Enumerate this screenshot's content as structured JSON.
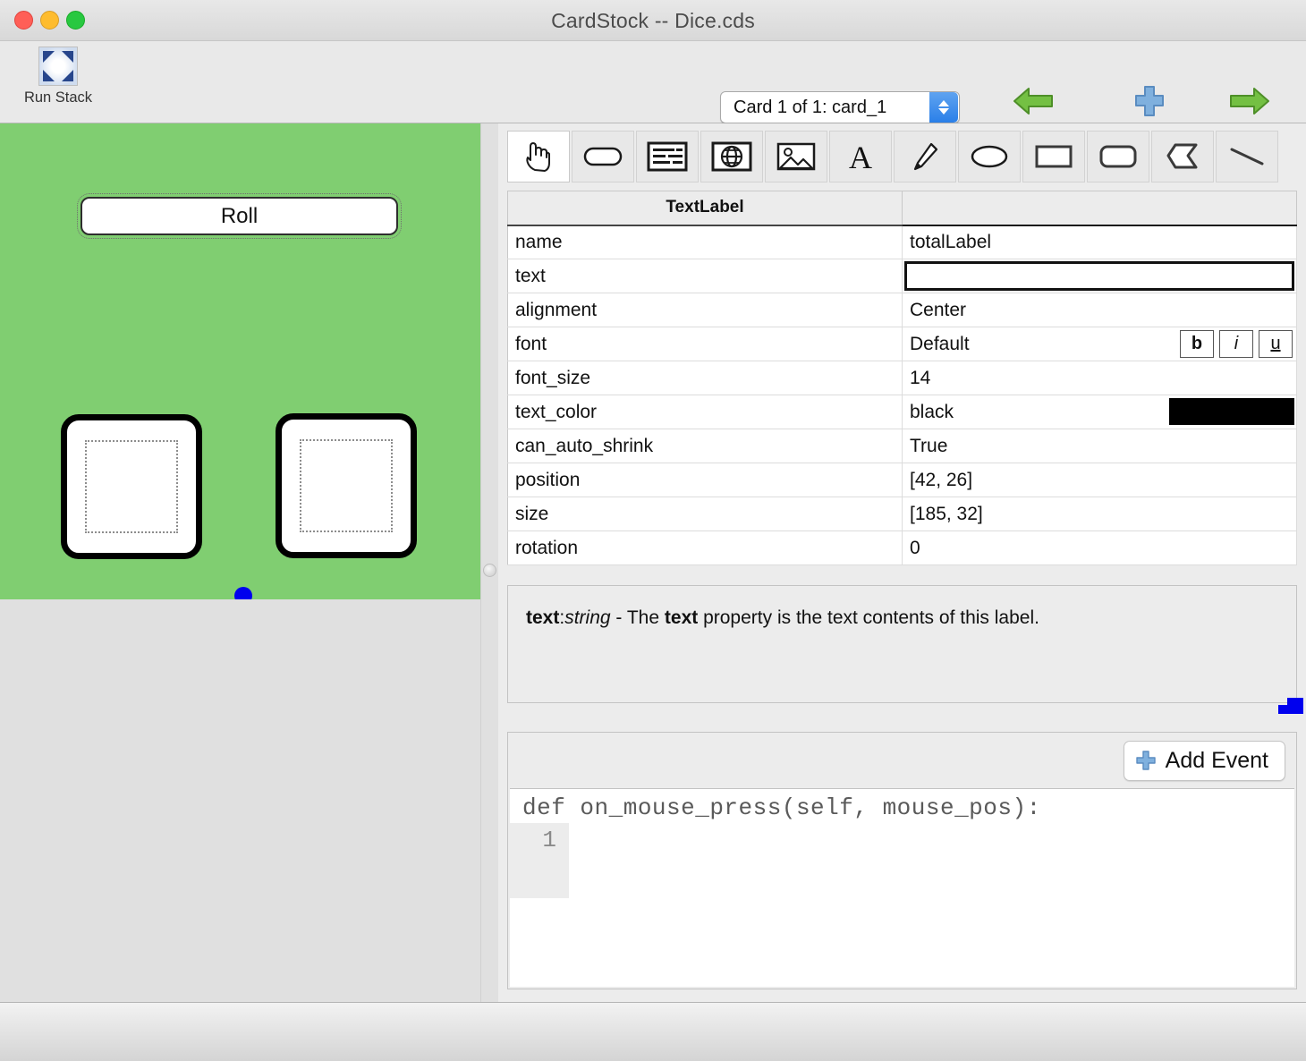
{
  "window": {
    "title": "CardStock -- Dice.cds",
    "traffic_lights": [
      "close-button",
      "minimize-button",
      "maximize-button"
    ]
  },
  "toolbar": {
    "run_stack_label": "Run Stack",
    "card_selector_value": "Card 1 of 1: card_1",
    "previous_card_label": "Previous Card",
    "add_card_label": "Add Card",
    "next_card_label": "Next Card"
  },
  "palette": {
    "tools": [
      {
        "name": "hand-tool",
        "icon": "pointing-hand-icon",
        "selected": true
      },
      {
        "name": "button-tool",
        "icon": "rounded-pill-icon",
        "selected": false
      },
      {
        "name": "textfield-tool",
        "icon": "text-field-icon",
        "selected": false
      },
      {
        "name": "webview-tool",
        "icon": "globe-icon",
        "selected": false
      },
      {
        "name": "image-tool",
        "icon": "picture-icon",
        "selected": false
      },
      {
        "name": "textlabel-tool",
        "icon": "letter-a-icon",
        "selected": false
      },
      {
        "name": "pen-tool",
        "icon": "pencil-icon",
        "selected": false
      },
      {
        "name": "oval-tool",
        "icon": "ellipse-icon",
        "selected": false
      },
      {
        "name": "rect-tool",
        "icon": "rectangle-icon",
        "selected": false
      },
      {
        "name": "roundrect-tool",
        "icon": "rounded-rectangle-icon",
        "selected": false
      },
      {
        "name": "polygon-tool",
        "icon": "polygon-icon",
        "selected": false
      },
      {
        "name": "line-tool",
        "icon": "line-icon",
        "selected": false
      }
    ]
  },
  "canvas": {
    "background_color": "#80ce71",
    "roll_button_label": "Roll",
    "dice": [
      "die-left",
      "die-right"
    ],
    "selection": {
      "handles": 4,
      "rotation_handle": true,
      "color": "#0000ee"
    }
  },
  "properties": {
    "header": {
      "type": "TextLabel",
      "value_header": ""
    },
    "rows": [
      {
        "key": "name",
        "value": "totalLabel",
        "kind": "text"
      },
      {
        "key": "text",
        "value": "",
        "kind": "editing"
      },
      {
        "key": "alignment",
        "value": "Center",
        "kind": "text"
      },
      {
        "key": "font",
        "value": "Default",
        "kind": "font"
      },
      {
        "key": "font_size",
        "value": "14",
        "kind": "text"
      },
      {
        "key": "text_color",
        "value": "black",
        "kind": "color",
        "swatch": "#000000"
      },
      {
        "key": "can_auto_shrink",
        "value": "True",
        "kind": "text"
      },
      {
        "key": "position",
        "value": "[42, 26]",
        "kind": "text"
      },
      {
        "key": "size",
        "value": "[185, 32]",
        "kind": "text"
      },
      {
        "key": "rotation",
        "value": "0",
        "kind": "text"
      }
    ],
    "style_buttons": {
      "bold": "b",
      "italic": "i",
      "underline": "u"
    }
  },
  "description": {
    "prop_name": "text",
    "prop_type": "string",
    "separator": " - ",
    "body_before": "The ",
    "body_bold": "text",
    "body_after": " property is the text contents of this label."
  },
  "code": {
    "add_event_label": "Add Event",
    "signature": "def on_mouse_press(self, mouse_pos):",
    "line_numbers": [
      "1"
    ],
    "lines": [
      ""
    ]
  },
  "colors": {
    "canvas_green": "#80ce71",
    "selection_blue": "#0000ee",
    "accent_blue": "#2a7fe8",
    "arrow_green": "#5cb531",
    "plus_blue": "#6f9fd8"
  }
}
